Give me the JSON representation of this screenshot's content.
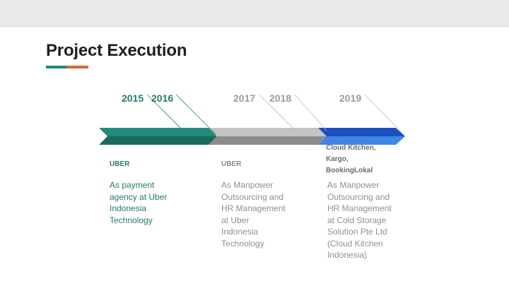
{
  "slide": {
    "title": "Project Execution",
    "accent_colors": {
      "teal": "#1f8b7c",
      "orange": "#e0662a",
      "grey": "#a7a9aa",
      "blue": "#1f5fd1"
    }
  },
  "timeline": {
    "years": [
      {
        "label": "2015",
        "color": "#217c6b"
      },
      {
        "label": "2016",
        "color": "#217c6b"
      },
      {
        "label": "2017",
        "color": "#9a9a9a"
      },
      {
        "label": "2018",
        "color": "#9a9a9a"
      },
      {
        "label": "2019",
        "color": "#9a9a9a"
      }
    ],
    "segments": [
      {
        "company": "UBER",
        "company_color": "#217c6b",
        "description": "As payment\nagency at Uber\nIndonesia\nTechnology",
        "desc_color": "#217c6b"
      },
      {
        "company": "UBER",
        "company_color": "#8a8a8a",
        "description": "As Manpower\nOutsourcing and\nHR Management\nat Uber\nIndonesia\nTechnology",
        "desc_color": "#8f8f8f"
      },
      {
        "company_lines": [
          "Cloud Kitchen,",
          "Kargo,",
          "BookingLokal"
        ],
        "company_color": "#6b6b6b",
        "description": "As Manpower\nOutsourcing and\nHR Management\nat Cold Storage\nSolution Pte Ltd\n(Cloud Kitchen\nIndonesia)",
        "desc_color": "#8f8f8f"
      }
    ]
  }
}
